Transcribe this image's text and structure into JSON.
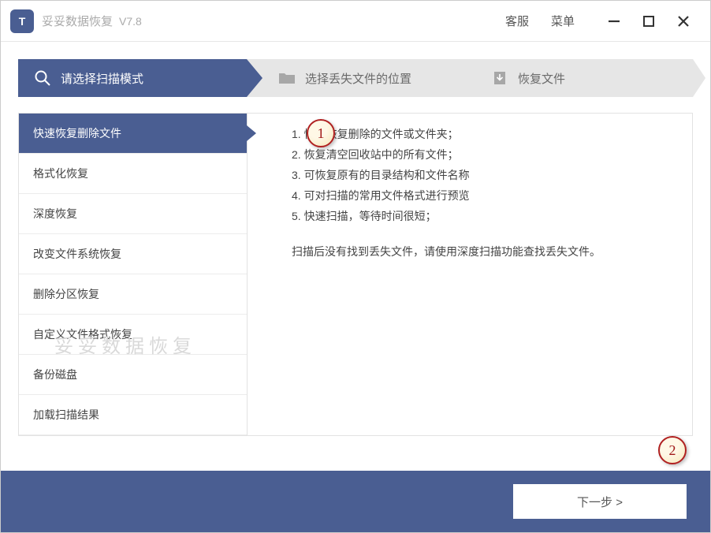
{
  "titlebar": {
    "logo_text": "T",
    "app_name": "妥妥数据恢复",
    "version": "V7.8",
    "links": {
      "support": "客服",
      "menu": "菜单"
    }
  },
  "steps": {
    "s1": "请选择扫描模式",
    "s2": "选择丢失文件的位置",
    "s3": "恢复文件"
  },
  "sidebar": {
    "items": [
      "快速恢复删除文件",
      "格式化恢复",
      "深度恢复",
      "改变文件系统恢复",
      "删除分区恢复",
      "自定义文件格式恢复",
      "备份磁盘",
      "加载扫描结果"
    ],
    "selected_index": 0
  },
  "description": {
    "lines": [
      "1. 快速恢复删除的文件或文件夹；",
      "2. 恢复清空回收站中的所有文件；",
      "3. 可恢复原有的目录结构和文件名称",
      "4. 可对扫描的常用文件格式进行预览",
      "5. 快速扫描，等待时间很短；"
    ],
    "note": "扫描后没有找到丢失文件，请使用深度扫描功能查找丢失文件。"
  },
  "footer": {
    "next": "下一步 >"
  },
  "watermark": "妥妥数据恢复",
  "annotations": {
    "a1": "1",
    "a2": "2"
  }
}
